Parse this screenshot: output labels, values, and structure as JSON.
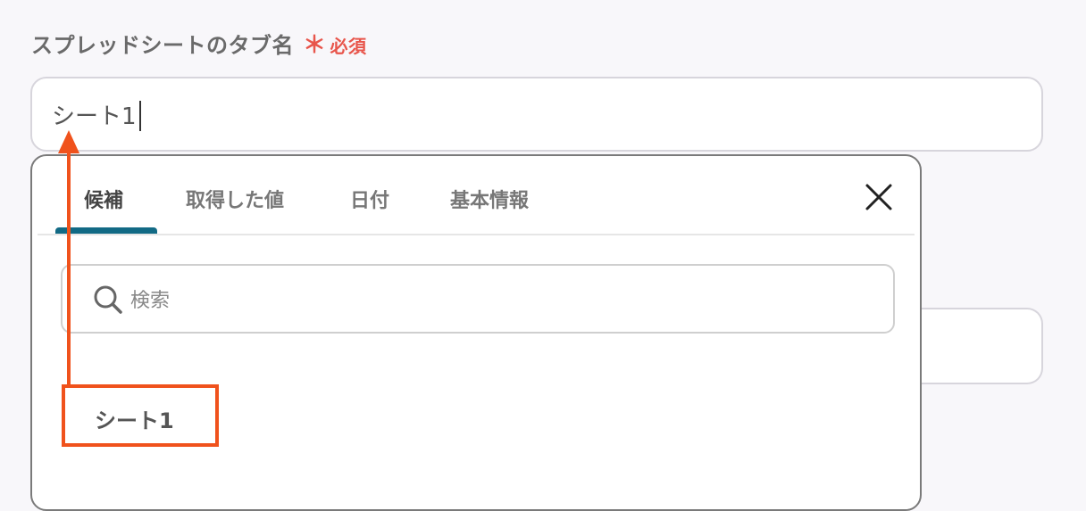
{
  "field": {
    "label": "スプレッドシートのタブ名",
    "required_mark": "＊",
    "required_text": "必須",
    "value": "シート1"
  },
  "popup": {
    "tabs": [
      {
        "label": "候補",
        "active": true
      },
      {
        "label": "取得した値",
        "active": false
      },
      {
        "label": "日付",
        "active": false
      },
      {
        "label": "基本情報",
        "active": false
      }
    ],
    "search_placeholder": "検索",
    "candidates": [
      "シート1"
    ]
  },
  "colors": {
    "accent": "#126a85",
    "required": "#e8554b",
    "annotation": "#f0521c"
  },
  "icons": {
    "close": "close-icon",
    "search": "search-icon"
  }
}
